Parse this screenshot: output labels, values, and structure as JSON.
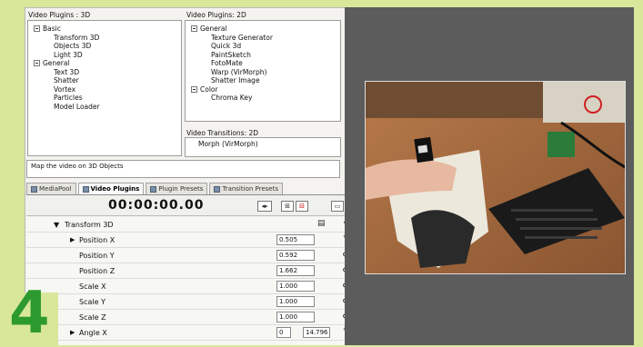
{
  "step_number": "4",
  "left_panel": {
    "title": "Video Plugins : 3D",
    "tree": [
      {
        "label": "Basic",
        "level": 0,
        "expander": true
      },
      {
        "label": "Transform 3D",
        "level": 1
      },
      {
        "label": "Objects 3D",
        "level": 1
      },
      {
        "label": "Light 3D",
        "level": 1
      },
      {
        "label": "General",
        "level": 0,
        "expander": true
      },
      {
        "label": "Text 3D",
        "level": 1
      },
      {
        "label": "Shatter",
        "level": 1
      },
      {
        "label": "Vortex",
        "level": 1
      },
      {
        "label": "Particles",
        "level": 1
      },
      {
        "label": "Model Loader",
        "level": 1
      }
    ]
  },
  "right_panel": {
    "title": "Video Plugins: 2D",
    "tree": [
      {
        "label": "General",
        "level": 0,
        "expander": true
      },
      {
        "label": "Texture Generator",
        "level": 1
      },
      {
        "label": "Quick 3d",
        "level": 1
      },
      {
        "label": "PaintSketch",
        "level": 1
      },
      {
        "label": "FotoMate",
        "level": 1
      },
      {
        "label": "Warp (VirMorph)",
        "level": 1
      },
      {
        "label": "Shatter Image",
        "level": 1
      },
      {
        "label": "Color",
        "level": 0,
        "expander": true
      },
      {
        "label": "Chroma Key",
        "level": 1
      }
    ]
  },
  "transitions": {
    "title": "Video Transitions: 2D",
    "item": "Morph (VirMorph)"
  },
  "description": "Map the video on 3D Objects",
  "tabs": [
    {
      "label": "MediaPool",
      "active": false
    },
    {
      "label": "Video Plugins",
      "active": true
    },
    {
      "label": "Plugin Presets",
      "active": false
    },
    {
      "label": "Transition Presets",
      "active": false
    }
  ],
  "timeline": {
    "timecode": "00:00:00.00",
    "btn1": "◂▸",
    "btn2": "⊞",
    "btn3": "⊟"
  },
  "params": {
    "group": "Transform 3D",
    "rows": [
      {
        "label": "Position X",
        "value": "0.505",
        "arrow": true,
        "icon": "pen"
      },
      {
        "label": "Position Y",
        "value": "0.592",
        "arrow": false,
        "icon": "eye"
      },
      {
        "label": "Position Z",
        "value": "1.662",
        "arrow": false,
        "icon": "eye"
      },
      {
        "label": "Scale X",
        "value": "1.000",
        "arrow": false,
        "icon": "eye"
      },
      {
        "label": "Scale Y",
        "value": "1.000",
        "arrow": false,
        "icon": "eye"
      },
      {
        "label": "Scale Z",
        "value": "1.000",
        "arrow": false,
        "icon": "eye"
      },
      {
        "label": "Angle X",
        "value": "0",
        "value2": "14.796",
        "arrow": true,
        "icon": "pen"
      }
    ]
  },
  "colors": {
    "badge": "#2d9a2f",
    "page": "#d9e79a",
    "preview_bg": "#5c5c5c"
  }
}
